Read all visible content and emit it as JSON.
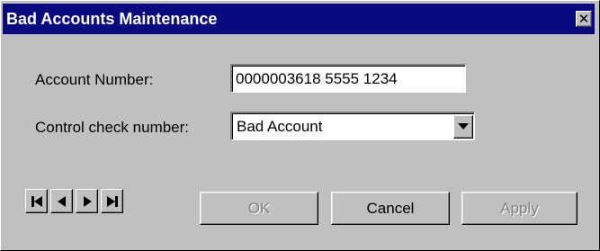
{
  "window": {
    "title": "Bad Accounts Maintenance",
    "close_glyph": "✕",
    "titlebar_color": "#0a0a80",
    "face_color": "#c0c0c0"
  },
  "form": {
    "account_label": "Account Number:",
    "account_value": "0000003618 5555 1234",
    "control_label": "Control check number:",
    "control_selected": "Bad Account"
  },
  "navigation": {
    "first_icon": "first-record-icon",
    "prev_icon": "previous-record-icon",
    "next_icon": "next-record-icon",
    "last_icon": "last-record-icon"
  },
  "buttons": {
    "ok_label": "OK",
    "ok_enabled": false,
    "cancel_label": "Cancel",
    "cancel_enabled": true,
    "apply_label": "Apply",
    "apply_enabled": false
  }
}
